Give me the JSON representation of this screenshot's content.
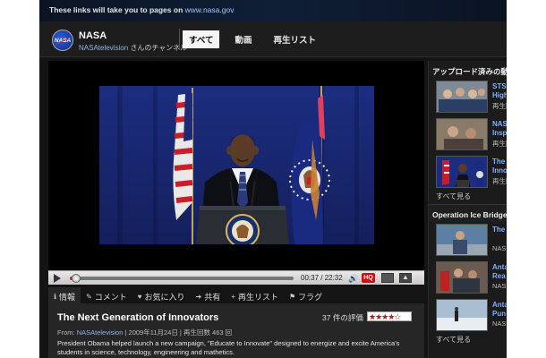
{
  "banner": {
    "text": "These links will take you to pages on",
    "link": "www.nasa.gov"
  },
  "channel": {
    "logo_text": "NASA",
    "name": "NASA",
    "user": "NASAtelevision",
    "user_suffix": " さんのチャンネル",
    "tabs": [
      {
        "label": "すべて",
        "active": true
      },
      {
        "label": "動画",
        "active": false
      },
      {
        "label": "再生リスト",
        "active": false
      }
    ]
  },
  "player": {
    "time": "00:37 / 22:32",
    "progress": 0.028,
    "hq_label": "HQ"
  },
  "info_tabs": [
    {
      "icon": "info-icon",
      "glyph": "ℹ",
      "label": "情報",
      "active": true
    },
    {
      "icon": "comment-icon",
      "glyph": "✎",
      "label": "コメント",
      "active": false
    },
    {
      "icon": "heart-icon",
      "glyph": "♥",
      "label": "お気に入り",
      "active": false
    },
    {
      "icon": "share-icon",
      "glyph": "➜",
      "label": "共有",
      "active": false
    },
    {
      "icon": "plus-icon",
      "glyph": "+",
      "label": "再生リスト",
      "active": false
    },
    {
      "icon": "flag-icon",
      "glyph": "⚑",
      "label": "フラグ",
      "active": false
    }
  ],
  "video": {
    "title": "The Next Generation of Innovators",
    "rating_text": "37 件の評価",
    "stars": 4.5,
    "from_label": "From:",
    "from_user": "NASAtelevision",
    "date": "2009年11月24日",
    "views": "再生回数 463 回",
    "description": "President Obama helped launch a new campaign, \"Educate to Innovate\" designed to energize and excite America's students in science, technology, engineering and mathetics."
  },
  "sidebar": {
    "sections": [
      {
        "title": "アップロード済みの動",
        "items": [
          {
            "line1": "STS",
            "line2": "High",
            "line3": "再生回"
          },
          {
            "line1": "NAS",
            "line2": "Insp",
            "line3": "再生回"
          },
          {
            "line1": "The",
            "line2": "Inno",
            "line3": "再生回"
          }
        ],
        "see_all": "すべて見る"
      },
      {
        "title": "Operation Ice Bridge",
        "items": [
          {
            "line1": "The",
            "line2": "",
            "line3": "NAS"
          },
          {
            "line1": "Anta",
            "line2": "Rea",
            "line3": "NAS"
          },
          {
            "line1": "Anta",
            "line2": "Pun",
            "line3": "NAS"
          }
        ],
        "see_all": "すべて見る"
      }
    ]
  },
  "colors": {
    "accent_link": "#8fb8e8",
    "hq_red": "#cc1111",
    "bg": "#141414"
  }
}
